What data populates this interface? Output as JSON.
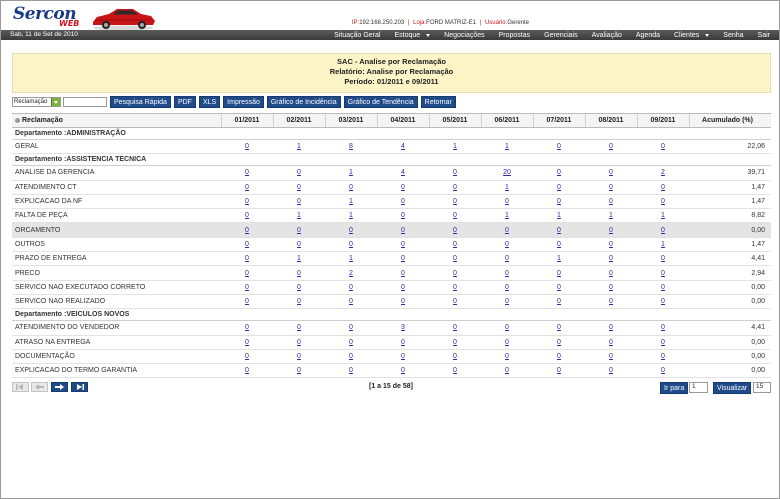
{
  "header": {
    "logo_text": "Sercon",
    "logo_sub": "WEB",
    "ip_label": "IP:",
    "ip_value": "192.168.250.203",
    "loja_label": "Loja:",
    "loja_value": "FORD MATRIZ-E1",
    "usuario_label": "Usuário:",
    "usuario_value": "Gerente"
  },
  "nav": {
    "date": "Sab, 11 de Set de 2010",
    "items": [
      {
        "label": "Situação Geral",
        "caret": false
      },
      {
        "label": "Estoque",
        "caret": true
      },
      {
        "label": "Negociações",
        "caret": false
      },
      {
        "label": "Propostas",
        "caret": false
      },
      {
        "label": "Gerenciais",
        "caret": false
      },
      {
        "label": "Avaliação",
        "caret": false
      },
      {
        "label": "Agenda",
        "caret": false
      },
      {
        "label": "Clientes",
        "caret": true
      },
      {
        "label": "Senha",
        "caret": false
      },
      {
        "label": "Sair",
        "caret": false
      }
    ]
  },
  "title": {
    "line1": "SAC - Analise por Reclamação",
    "line2": "Relatório: Analise por Reclamação",
    "line3": "Período: 01/2011 e 09/2011"
  },
  "toolbar": {
    "filter_value": "Reclamação",
    "search_value": "",
    "buttons": {
      "quick_search": "Pesquisa Rápida",
      "pdf": "PDF",
      "xls": "XLS",
      "print": "Impressão",
      "incidence_chart": "Gráfico de Incidência",
      "trend_chart": "Gráfico de Tendência",
      "back": "Retornar"
    }
  },
  "table": {
    "first_column_header": "Reclamação",
    "month_headers": [
      "01/2011",
      "02/2011",
      "03/2011",
      "04/2011",
      "05/2011",
      "06/2011",
      "07/2011",
      "08/2011",
      "09/2011"
    ],
    "accumulated_header": "Acumulado (%)",
    "dept_label": "Departamento :",
    "departments": [
      {
        "name": "ADMINISTRAÇÃO",
        "rows": [
          {
            "label": "GERAL",
            "values": [
              "0",
              "1",
              "8",
              "4",
              "1",
              "1",
              "0",
              "0",
              "0"
            ],
            "acc": "22,06",
            "highlight": false
          }
        ]
      },
      {
        "name": "ASSISTENCIA TECNICA",
        "rows": [
          {
            "label": "ANALISE DA GERENCIA",
            "values": [
              "0",
              "0",
              "1",
              "4",
              "0",
              "20",
              "0",
              "0",
              "2"
            ],
            "acc": "39,71",
            "highlight": false
          },
          {
            "label": "ATENDIMENTO CT",
            "values": [
              "0",
              "0",
              "0",
              "0",
              "0",
              "1",
              "0",
              "0",
              "0"
            ],
            "acc": "1,47",
            "highlight": false
          },
          {
            "label": "EXPLICACAO DA NF",
            "values": [
              "0",
              "0",
              "1",
              "0",
              "0",
              "0",
              "0",
              "0",
              "0"
            ],
            "acc": "1,47",
            "highlight": false
          },
          {
            "label": "FALTA DE PEÇA",
            "values": [
              "0",
              "1",
              "1",
              "0",
              "0",
              "1",
              "1",
              "1",
              "1"
            ],
            "acc": "8,82",
            "highlight": false
          },
          {
            "label": "ORCAMENTO",
            "values": [
              "0",
              "0",
              "0",
              "0",
              "0",
              "0",
              "0",
              "0",
              "0"
            ],
            "acc": "0,00",
            "highlight": true
          },
          {
            "label": "OUTROS",
            "values": [
              "0",
              "0",
              "0",
              "0",
              "0",
              "0",
              "0",
              "0",
              "1"
            ],
            "acc": "1,47",
            "highlight": false
          },
          {
            "label": "PRAZO DE ENTREGA",
            "values": [
              "0",
              "1",
              "1",
              "0",
              "0",
              "0",
              "1",
              "0",
              "0"
            ],
            "acc": "4,41",
            "highlight": false
          },
          {
            "label": "PRECO",
            "values": [
              "0",
              "0",
              "2",
              "0",
              "0",
              "0",
              "0",
              "0",
              "0"
            ],
            "acc": "2,94",
            "highlight": false
          },
          {
            "label": "SERVICO NAO EXECUTADO CORRETO",
            "values": [
              "0",
              "0",
              "0",
              "0",
              "0",
              "0",
              "0",
              "0",
              "0"
            ],
            "acc": "0,00",
            "highlight": false
          },
          {
            "label": "SERVICO NAO REALIZADO",
            "values": [
              "0",
              "0",
              "0",
              "0",
              "0",
              "0",
              "0",
              "0",
              "0"
            ],
            "acc": "0,00",
            "highlight": false
          }
        ]
      },
      {
        "name": "VEICULOS NOVOS",
        "rows": [
          {
            "label": "ATENDIMENTO DO VENDEDOR",
            "values": [
              "0",
              "0",
              "0",
              "3",
              "0",
              "0",
              "0",
              "0",
              "0"
            ],
            "acc": "4,41",
            "highlight": false
          },
          {
            "label": "ATRASO NA ENTREGA",
            "values": [
              "0",
              "0",
              "0",
              "0",
              "0",
              "0",
              "0",
              "0",
              "0"
            ],
            "acc": "0,00",
            "highlight": false
          },
          {
            "label": "DOCUMENTAÇÃO",
            "values": [
              "0",
              "0",
              "0",
              "0",
              "0",
              "0",
              "0",
              "0",
              "0"
            ],
            "acc": "0,00",
            "highlight": false
          },
          {
            "label": "EXPLICACAO DO TERMO GARANTIA",
            "values": [
              "0",
              "0",
              "0",
              "0",
              "0",
              "0",
              "0",
              "0",
              "0"
            ],
            "acc": "0,00",
            "highlight": false
          }
        ]
      }
    ]
  },
  "pager": {
    "range_text": "[1 a 15 de 58]",
    "goto_label": "Ir para",
    "goto_value": "1",
    "view_label": "Visualizar",
    "per_page_value": "15"
  },
  "colors": {
    "nav_bg": "#3f3f3f",
    "button_bg": "#1f4b8a",
    "title_bg": "#fdf5c8",
    "link": "#2a2aa8",
    "accent_red": "#c8161d",
    "highlight_row": "#e4e4e4"
  }
}
